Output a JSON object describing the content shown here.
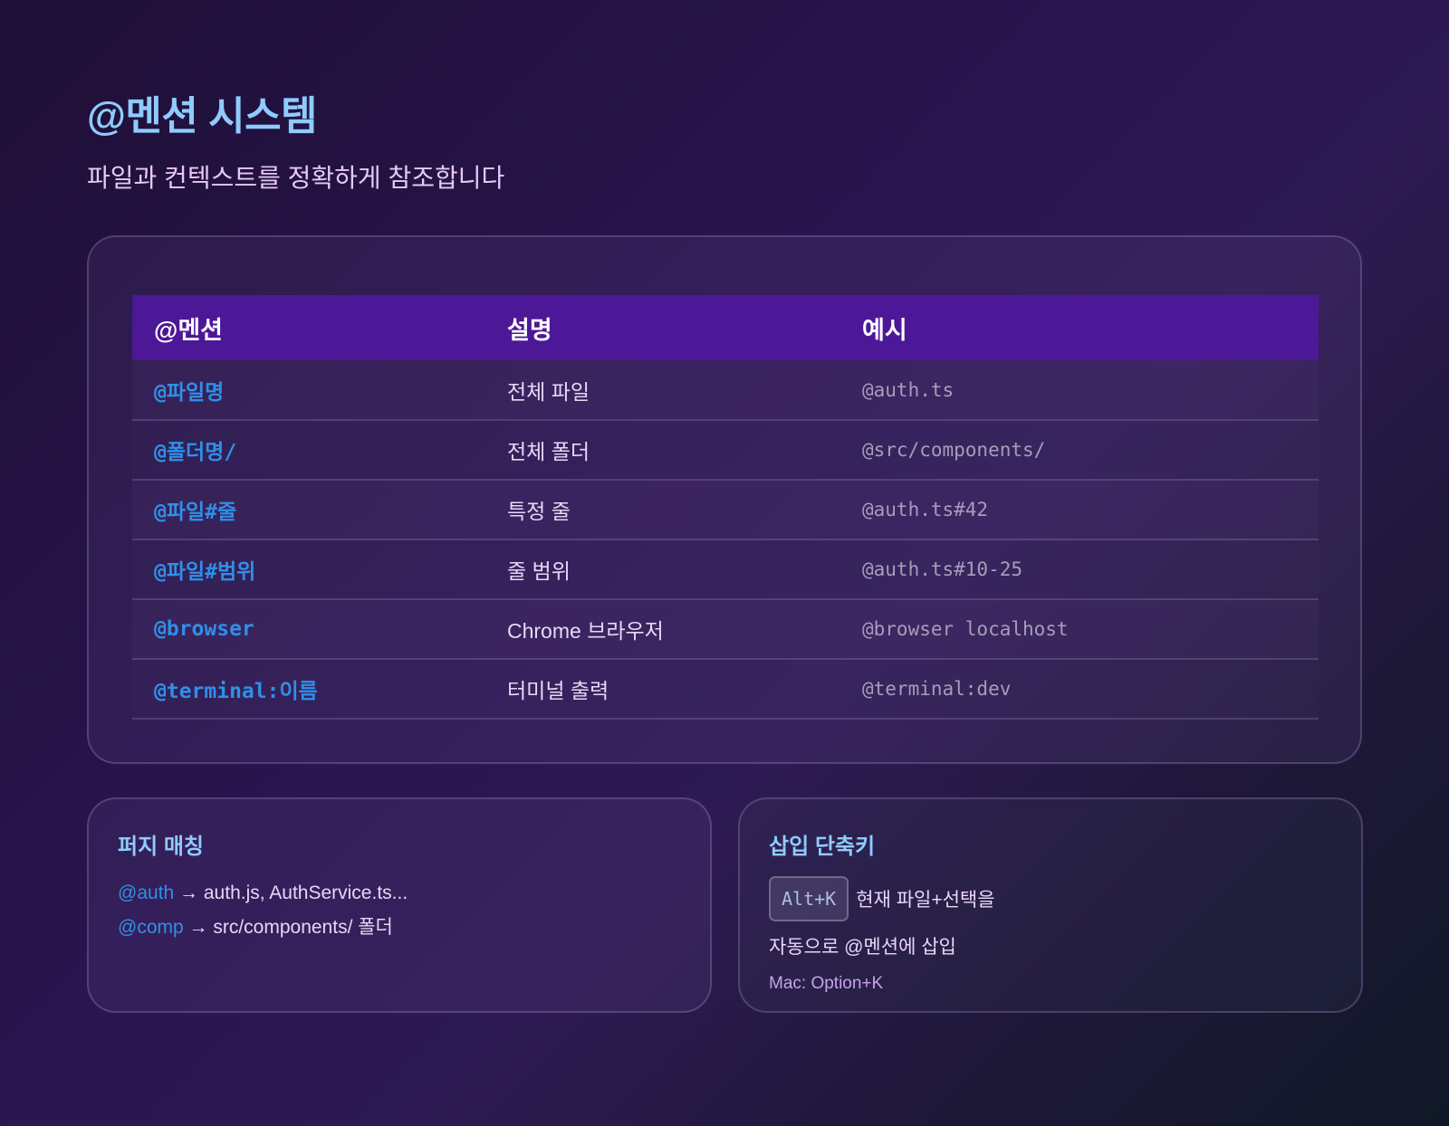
{
  "header": {
    "title": "@멘션 시스템",
    "subtitle": "파일과 컨텍스트를 정확하게 참조합니다"
  },
  "table": {
    "headers": [
      "@멘션",
      "설명",
      "예시"
    ],
    "rows": [
      {
        "mention": "@파일명",
        "desc": "전체 파일",
        "example": "@auth.ts"
      },
      {
        "mention": "@폴더명/",
        "desc": "전체 폴더",
        "example": "@src/components/"
      },
      {
        "mention": "@파일#줄",
        "desc": "특정 줄",
        "example": "@auth.ts#42"
      },
      {
        "mention": "@파일#범위",
        "desc": "줄 범위",
        "example": "@auth.ts#10-25"
      },
      {
        "mention": "@browser",
        "desc": "Chrome 브라우저",
        "example": "@browser localhost"
      },
      {
        "mention": "@terminal:이름",
        "desc": "터미널 출력",
        "example": "@terminal:dev"
      }
    ]
  },
  "fuzzy": {
    "title": "퍼지 매칭",
    "lines": [
      {
        "mention": "@auth",
        "rest": " → auth.js, AuthService.ts..."
      },
      {
        "mention": "@comp",
        "rest": " → src/components/ 폴더"
      }
    ]
  },
  "shortcut": {
    "title": "삽입 단축키",
    "key": "Alt+K",
    "text1": "현재 파일+선택을",
    "text2": "자동으로 @멘션에 삽입",
    "note": "Mac: Option+K"
  },
  "colors": {
    "title": "#8fcbff",
    "header_row": "#4c1897",
    "mention": "#2f8fe8",
    "example": "#a89cbb"
  }
}
